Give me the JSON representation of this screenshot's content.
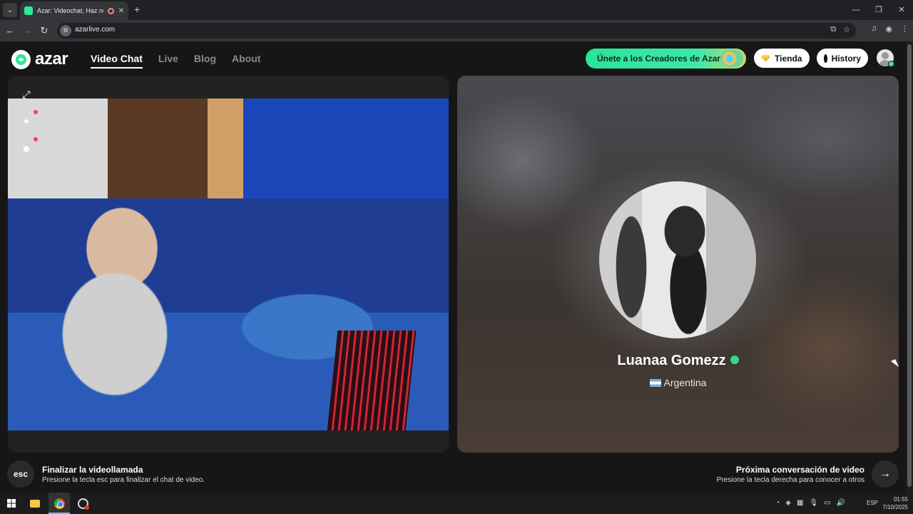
{
  "browser": {
    "tab_title": "Azar: Videochat, Haz nuev",
    "url": "azarlive.com",
    "icons": [
      "back-arrow-icon",
      "forward-arrow-icon",
      "reload-icon",
      "site-info-icon",
      "cast-icon",
      "bookmark-star-icon",
      "media-icon",
      "profile-icon",
      "menu-icon"
    ]
  },
  "header": {
    "logo_text": "azar",
    "nav": [
      {
        "label": "Video Chat",
        "active": true
      },
      {
        "label": "Live",
        "active": false
      },
      {
        "label": "Blog",
        "active": false
      },
      {
        "label": "About",
        "active": false
      }
    ],
    "creators_label": "Únete a los Creadores de Azar",
    "shop_label": "Tienda",
    "history_label": "History"
  },
  "left_panel": {
    "tools": [
      "expand-icon",
      "sparkle-effects-icon",
      "sticker-icon"
    ]
  },
  "partner": {
    "name": "Luanaa Gomezz",
    "country": "Argentina"
  },
  "footer": {
    "esc_key": "esc",
    "end_title": "Finalizar la videollamada",
    "end_sub": "Presione la tecla esc para finalizar el chat de video.",
    "next_title": "Próxima conversación de video",
    "next_sub": "Presione la tecla derecha para conocer a otros"
  },
  "taskbar": {
    "language": "ESP",
    "time": "01:55",
    "date": "7/10/2025"
  },
  "colors": {
    "brand_green": "#2ee89b",
    "background": "#161616",
    "panel": "#222222"
  }
}
